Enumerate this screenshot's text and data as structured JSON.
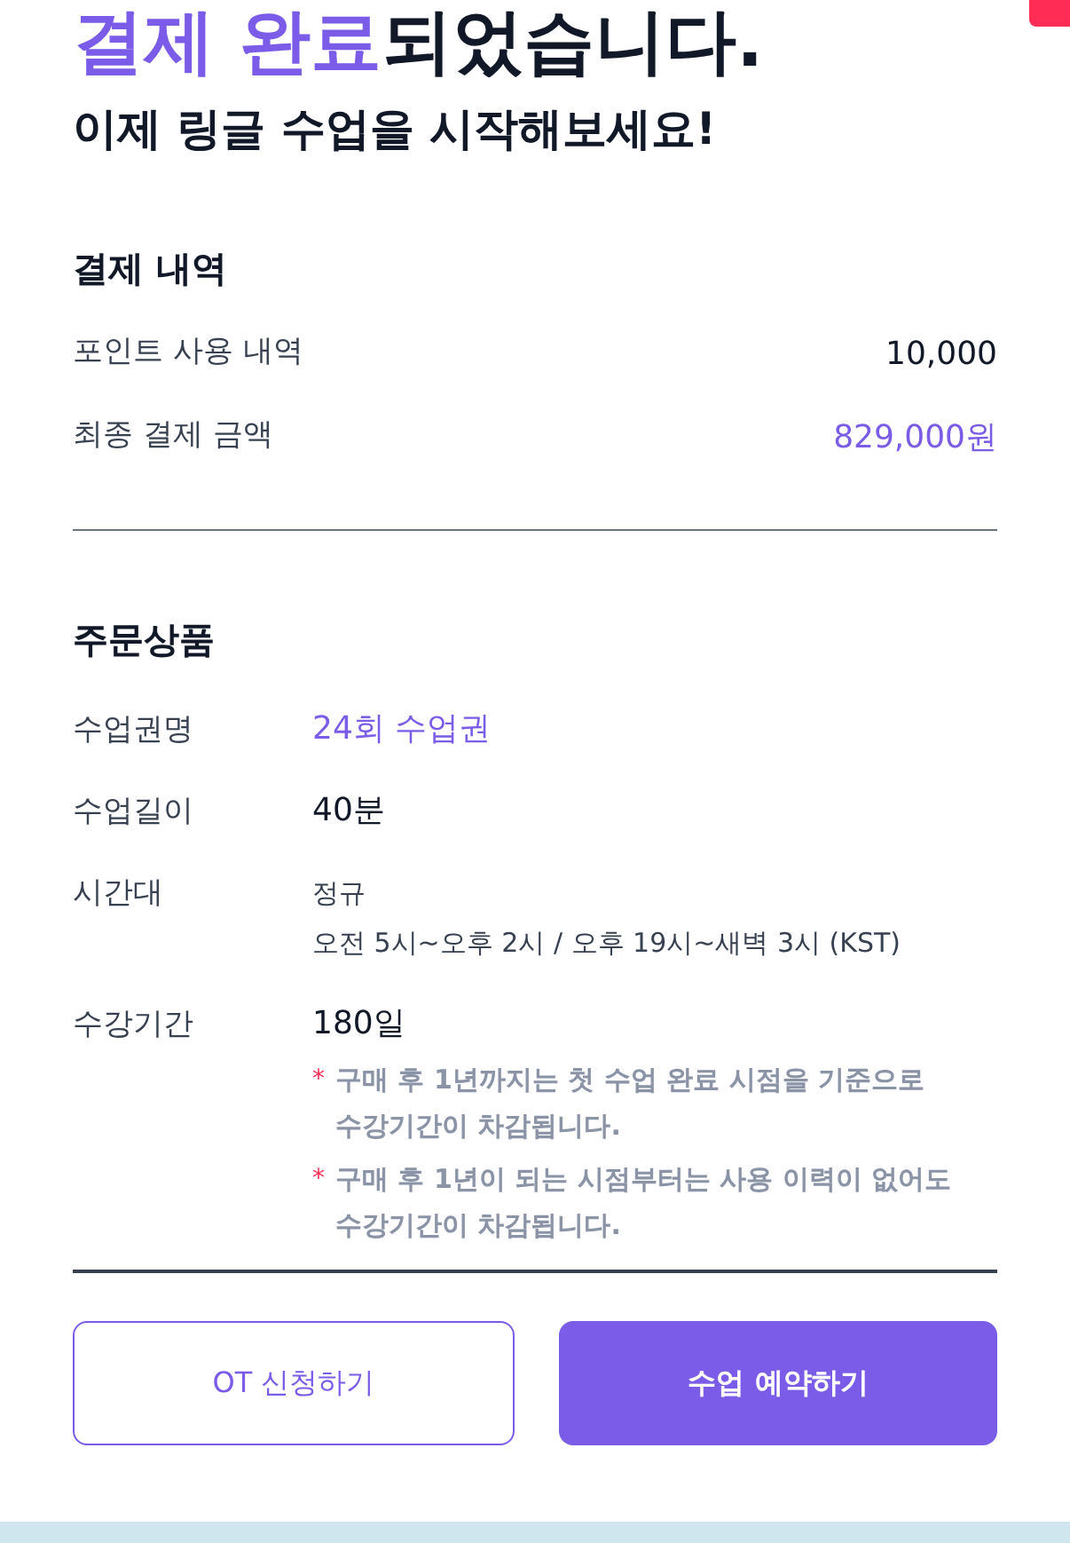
{
  "title": {
    "highlight": "결제 완료",
    "rest": "되었습니다."
  },
  "subtitle": "이제 링글 수업을 시작해보세요!",
  "payment": {
    "heading": "결제 내역",
    "rows": [
      {
        "label": "포인트 사용 내역",
        "value": "10,000",
        "kind": "plain"
      },
      {
        "label": "최종 결제 금액",
        "value": "829,000원",
        "kind": "accent"
      }
    ]
  },
  "order": {
    "heading": "주문상품",
    "rows": [
      {
        "label": "수업권명",
        "kind": "accent",
        "lines": [
          "24회 수업권"
        ]
      },
      {
        "label": "수업길이",
        "kind": "plain",
        "lines": [
          "40분"
        ]
      },
      {
        "label": "시간대",
        "kind": "small",
        "lines": [
          "정규",
          "오전 5시~오후 2시 / 오후 19시~새벽 3시 (KST)"
        ]
      },
      {
        "label": "수강기간",
        "kind": "plain",
        "lines": [
          "180일"
        ],
        "notes": [
          {
            "mark": "*",
            "text": "구매 후 1년까지는 첫 수업 완료 시점을 기준으로 수강기간이 차감됩니다."
          },
          {
            "mark": "*",
            "text": "구매 후 1년이 되는 시점부터는 사용 이력이 없어도 수강기간이 차감됩니다."
          }
        ]
      }
    ]
  },
  "buttons": [
    {
      "label": "OT 신청하기",
      "kind": "outline"
    },
    {
      "label": "수업 예약하기",
      "kind": "primary"
    }
  ]
}
